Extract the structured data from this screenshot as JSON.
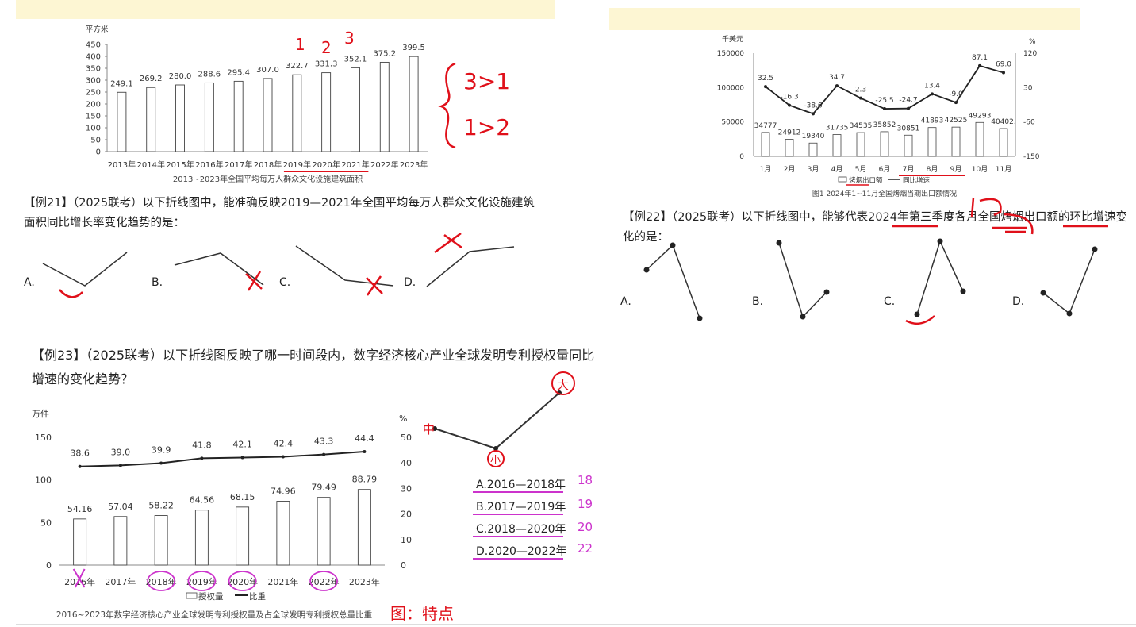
{
  "chart1": {
    "unit": "平方米",
    "yticks": [
      "450",
      "400",
      "350",
      "300",
      "250",
      "200",
      "150",
      "100",
      "50",
      "0"
    ],
    "caption": "2013~2023年全国平均每万人群众文化设施建筑面积",
    "chart_data": {
      "type": "bar",
      "categories": [
        "2013年",
        "2014年",
        "2015年",
        "2016年",
        "2017年",
        "2018年",
        "2019年",
        "2020年",
        "2021年",
        "2022年",
        "2023年"
      ],
      "values": [
        249.1,
        269.2,
        280.0,
        288.6,
        295.4,
        307.0,
        322.7,
        331.3,
        352.1,
        375.2,
        399.5
      ],
      "value_labels": [
        "249.1",
        "269.2",
        "280.0",
        "288.6",
        "295.4",
        "307.0",
        "322.7",
        "331.3",
        "352.1",
        "375.2",
        "399.5"
      ],
      "ylabel": "平方米",
      "ylim": [
        0,
        450
      ],
      "title": "2013~2023年全国平均每万人群众文化设施建筑面积"
    }
  },
  "q21": {
    "text": "【例21】（2025联考）以下折线图中，能准确反映2019—2021年全国平均每万人群众文化设施建筑面积同比增长率变化趋势的是：",
    "options": [
      "A.",
      "B.",
      "C.",
      "D."
    ]
  },
  "chart2": {
    "left_unit": "千美元",
    "right_unit": "%",
    "left_ticks": [
      "150000",
      "100000",
      "50000",
      "0"
    ],
    "right_ticks": [
      "120",
      "30",
      "-60",
      "-150"
    ],
    "legend": [
      "烤烟出口额",
      "同比增速"
    ],
    "caption": "图1  2024年1~11月全国烤烟当期出口额情况",
    "chart_data": {
      "type": "bar",
      "categories": [
        "1月",
        "2月",
        "3月",
        "4月",
        "5月",
        "6月",
        "7月",
        "8月",
        "9月",
        "10月",
        "11月"
      ],
      "series": [
        {
          "name": "烤烟出口额",
          "values": [
            34777,
            24912,
            19340,
            31735,
            34535,
            35852,
            30851,
            41893,
            42525,
            49293,
            40402
          ]
        },
        {
          "name": "同比增速",
          "values": [
            32.5,
            -16.3,
            -38.6,
            34.7,
            2.3,
            -25.5,
            -24.7,
            13.4,
            -9.0,
            87.1,
            69.0
          ]
        }
      ],
      "bar_labels": [
        "34777",
        "24912",
        "19340",
        "31735",
        "34535",
        "35852",
        "30851",
        "41893",
        "42525",
        "49293",
        "40402."
      ],
      "line_labels": [
        "32.5",
        "-16.3",
        "-38.6",
        "34.7",
        "2.3",
        "-25.5",
        "-24.7",
        "13.4",
        "-9.0",
        "87.1",
        "69.0"
      ],
      "ylim_left": [
        0,
        150000
      ],
      "ylim_right": [
        -150,
        120
      ],
      "ylabel": "千美元",
      "y2label": "%",
      "title": "图1  2024年1~11月全国烤烟当期出口额情况"
    }
  },
  "q22": {
    "text": "【例22】（2025联考）以下折线图中，能够代表2024年第三季度各月全国烤烟出口额的环比增速变化的是：",
    "options": [
      "A.",
      "B.",
      "C.",
      "D."
    ]
  },
  "q23": {
    "text": "【例23】（2025联考）以下折线图反映了哪一时间段内，数字经济核心产业全球发明专利授权量同比增速的变化趋势？",
    "options": [
      "A.2016—2018年",
      "B.2017—2019年",
      "C.2018—2020年",
      "D.2020—2022年"
    ]
  },
  "chart3": {
    "left_unit": "万件",
    "right_unit": "%",
    "left_ticks": [
      "150",
      "100",
      "50",
      "0"
    ],
    "right_ticks": [
      "50",
      "40",
      "30",
      "20",
      "10",
      "0"
    ],
    "legend": [
      "授权量",
      "比重"
    ],
    "caption": "2016~2023年数字经济核心产业全球发明专利授权量及占全球发明专利授权总量比重",
    "chart_data": {
      "type": "bar",
      "categories": [
        "2016年",
        "2017年",
        "2018年",
        "2019年",
        "2020年",
        "2021年",
        "2022年",
        "2023年"
      ],
      "series": [
        {
          "name": "授权量",
          "values": [
            54.16,
            57.04,
            58.22,
            64.56,
            68.15,
            74.96,
            79.49,
            88.79
          ]
        },
        {
          "name": "比重",
          "values": [
            38.6,
            39.0,
            39.9,
            41.8,
            42.1,
            42.4,
            43.3,
            44.4
          ]
        }
      ],
      "bar_labels": [
        "54.16",
        "57.04",
        "58.22",
        "64.56",
        "68.15",
        "74.96",
        "79.49",
        "88.79"
      ],
      "line_labels": [
        "38.6",
        "39.0",
        "39.9",
        "41.8",
        "42.1",
        "42.4",
        "43.3",
        "44.4"
      ],
      "ylim_left": [
        0,
        150
      ],
      "ylim_right": [
        0,
        50
      ],
      "ylabel": "万件",
      "y2label": "%",
      "title": "2016~2023年数字经济核心产业全球发明专利授权量及占全球发明专利授权总量比重"
    }
  },
  "annotations": {
    "top_digits": [
      "1",
      "2",
      "3"
    ],
    "brace_lines": [
      "3>1",
      "1>2"
    ],
    "nums23": [
      "18",
      "19",
      "20",
      "22"
    ],
    "small": "小",
    "big": "大",
    "mid": "中",
    "note": "图：特点"
  },
  "colors": {
    "annotation_red": "#e0101a",
    "annotation_purple": "#cc33cc",
    "highlight": "#fdf6d3"
  }
}
